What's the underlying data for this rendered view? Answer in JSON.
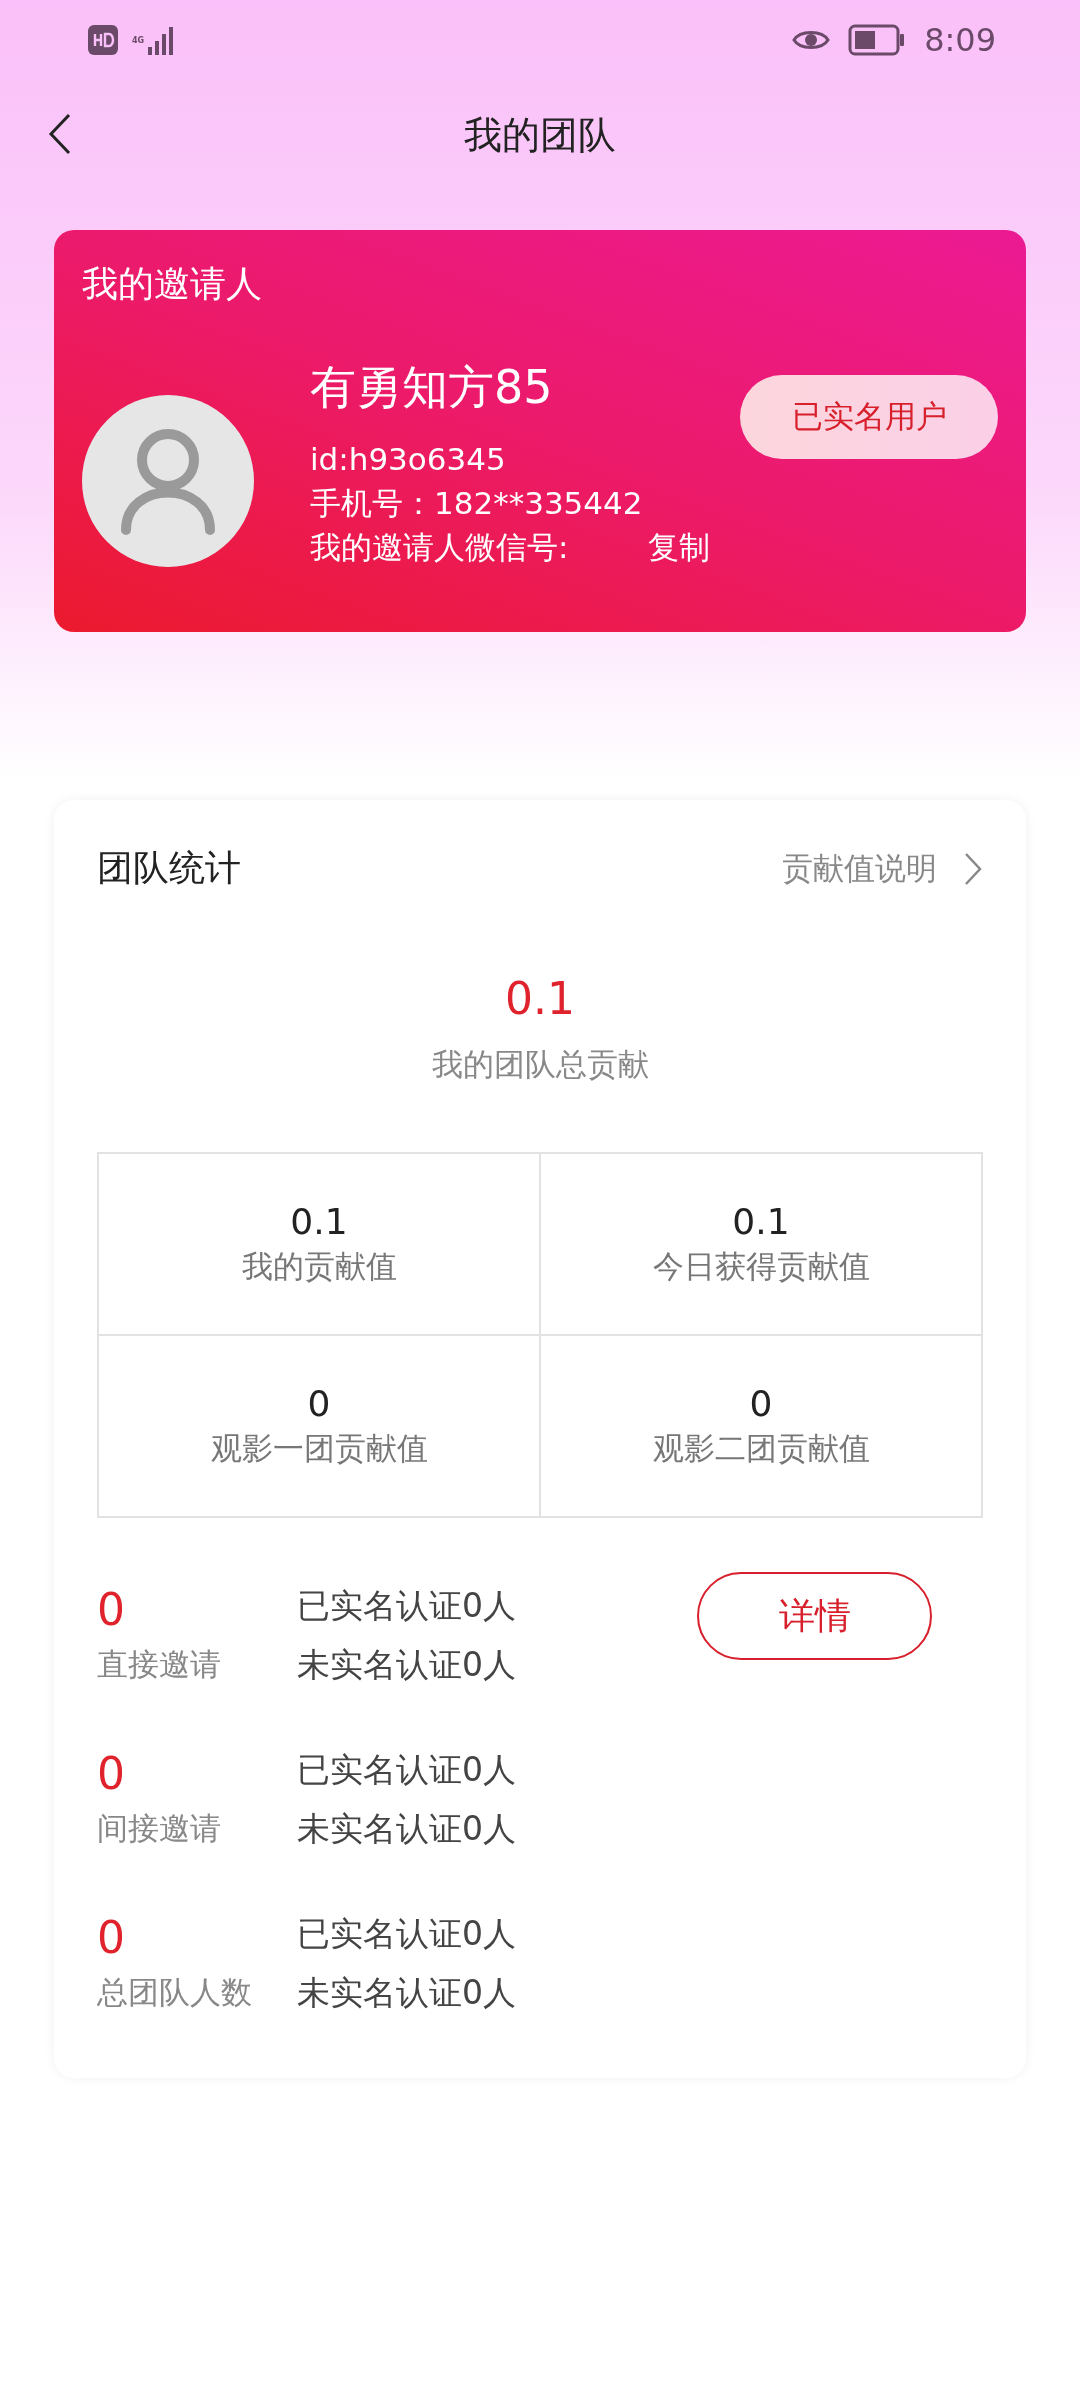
{
  "status_bar": {
    "time": "8:09",
    "network": "4G"
  },
  "header": {
    "title": "我的团队"
  },
  "inviter": {
    "heading": "我的邀请人",
    "name": "有勇知方85",
    "id": "id:h93o6345",
    "phone": "手机号：182**335442",
    "wechat_label": "我的邀请人微信号:",
    "copy": "复制",
    "badge": "已实名用户"
  },
  "stats": {
    "title": "团队统计",
    "help_link": "贡献值说明",
    "total_value": "0.1",
    "total_label": "我的团队总贡献",
    "grid": [
      {
        "value": "0.1",
        "label": "我的贡献值"
      },
      {
        "value": "0.1",
        "label": "今日获得贡献值"
      },
      {
        "value": "0",
        "label": "观影一团贡献值"
      },
      {
        "value": "0",
        "label": "观影二团贡献值"
      }
    ],
    "groups": [
      {
        "count": "0",
        "label": "直接邀请",
        "verified": "已实名认证0人",
        "unverified": "未实名认证0人",
        "button": "详情"
      },
      {
        "count": "0",
        "label": "间接邀请",
        "verified": "已实名认证0人",
        "unverified": "未实名认证0人"
      },
      {
        "count": "0",
        "label": "总团队人数",
        "verified": "已实名认证0人",
        "unverified": "未实名认证0人"
      }
    ]
  }
}
